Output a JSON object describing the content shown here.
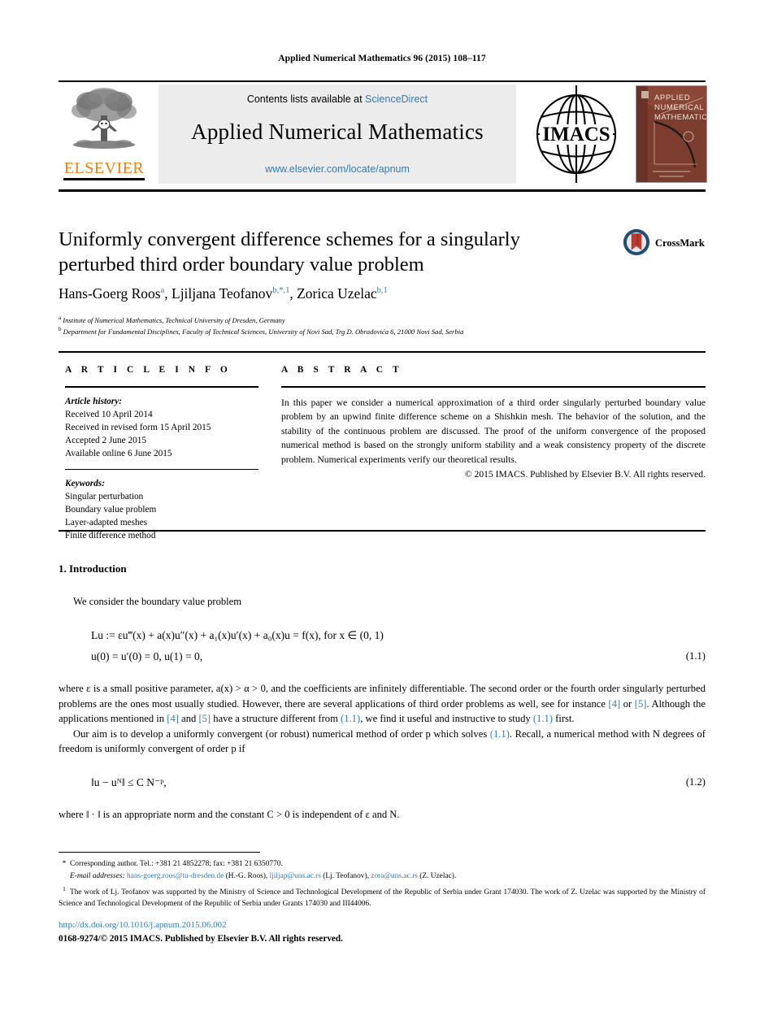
{
  "running_head": "Applied Numerical Mathematics 96 (2015) 108–117",
  "journal_header": {
    "publisher_name": "ELSEVIER",
    "contents_prefix": "Contents lists available at",
    "contents_link": "ScienceDirect",
    "journal_title": "Applied Numerical Mathematics",
    "journal_url": "www.elsevier.com/locate/apnum",
    "society_logo_text": "IMACS",
    "cover_lines": [
      "APPLIED",
      "NUMERICAL",
      "MATHEMATICS"
    ]
  },
  "article": {
    "title_line1": "Uniformly convergent difference schemes for a singularly",
    "title_line2": "perturbed third order boundary value problem",
    "crossmark_label": "CrossMark",
    "authors": [
      {
        "name": "Hans-Goerg Roos",
        "marks": "a"
      },
      {
        "name": "Ljiljana Teofanov",
        "marks": "b,*,1"
      },
      {
        "name": "Zorica Uzelac",
        "marks": "b,1"
      }
    ],
    "affiliations": [
      {
        "mark": "a",
        "text": "Institute of Numerical Mathematics, Technical University of Dresden, Germany"
      },
      {
        "mark": "b",
        "text": "Department for Fundamental Disciplines, Faculty of Technical Sciences, University of Novi Sad, Trg D. Obradovića 6, 21000 Novi Sad, Serbia"
      }
    ]
  },
  "info": {
    "heading": "A R T I C L E   I N F O",
    "history_title": "Article history:",
    "history": [
      "Received 10 April 2014",
      "Received in revised form 15 April 2015",
      "Accepted 2 June 2015",
      "Available online 6 June 2015"
    ],
    "keywords_title": "Keywords:",
    "keywords": [
      "Singular perturbation",
      "Boundary value problem",
      "Layer-adapted meshes",
      "Finite difference method"
    ]
  },
  "abstract": {
    "heading": "A B S T R A C T",
    "text": "In this paper we consider a numerical approximation of a third order singularly perturbed boundary value problem by an upwind finite difference scheme on a Shishkin mesh. The behavior of the solution, and the stability of the continuous problem are discussed. The proof of the uniform convergence of the proposed numerical method is based on the strongly uniform stability and a weak consistency property of the discrete problem. Numerical experiments verify our theoretical results.",
    "copyright": "© 2015 IMACS. Published by Elsevier B.V. All rights reserved."
  },
  "body": {
    "section_number": "1.",
    "section_title": "Introduction",
    "para_intro": "We consider the boundary value problem",
    "eq11_line1": "Lu := εu‴(x) + a(x)u″(x) + a₁(x)u′(x) + a₀(x)u = f(x),    for   x ∈ (0, 1)",
    "eq11_line2": "u(0) = u′(0) = 0,    u(1) = 0,",
    "eq11_num": "(1.1)",
    "para_where_1": "where ε is a small positive parameter, a(x) > α > 0, and the coefficients are infinitely differentiable. The second order or the fourth order singularly perturbed problems are the ones most usually studied. However, there are several applications of third order problems as well, see for instance ",
    "para_where_r1": "[4]",
    "para_where_2": " or ",
    "para_where_r2": "[5]",
    "para_where_3": ". Although the applications mentioned in ",
    "para_where_r3": "[4]",
    "para_where_4": " and ",
    "para_where_r4": "[5]",
    "para_where_5": " have a structure different from ",
    "para_where_r5": "(1.1)",
    "para_where_6": ", we find it useful and instructive to study ",
    "para_where_r6": "(1.1)",
    "para_where_7": " first.",
    "para_aim_1": "Our aim is to develop a uniformly convergent (or robust) numerical method of order p which solves ",
    "para_aim_r1": "(1.1)",
    "para_aim_2": ". Recall, a numerical method with N degrees of freedom is uniformly convergent of order p if",
    "eq12": "‖u − uᴺ‖ ≤ C N⁻ᵖ,",
    "eq12_num": "(1.2)",
    "para_norm": "where ‖ · ‖ is an appropriate norm and the constant C > 0 is independent of ε and N."
  },
  "footnotes": {
    "corresponding_mark": "*",
    "corresponding": "Corresponding author. Tel.: +381 21 4852278; fax: +381 21 6350770.",
    "email_label": "E-mail addresses:",
    "emails": [
      {
        "address": "hans-goerg.roos@tu-dresden.de",
        "owner": "(H.-G. Roos)"
      },
      {
        "address": "ljiljap@uns.ac.rs",
        "owner": "(Lj. Teofanov)"
      },
      {
        "address": "zora@uns.ac.rs",
        "owner": "(Z. Uzelac)"
      }
    ],
    "note_mark": "1",
    "note": "The work of Lj. Teofanov was supported by the Ministry of Science and Technological Development of the Republic of Serbia under Grant 174030. The work of Z. Uzelac was supported by the Ministry of Science and Technological Development of the Republic of Serbia under Grants 174030 and III44006."
  },
  "bottom": {
    "doi": "http://dx.doi.org/10.1016/j.apnum.2015.06.002",
    "issn_copyright": "0168-9274/© 2015 IMACS. Published by Elsevier B.V. All rights reserved."
  },
  "colors": {
    "link": "#2E7EBB",
    "elsevier_orange": "#F07F13",
    "banner_bg": "#ececec",
    "cover_brown": "#7a3b2e",
    "crossmark_blue": "#1f4e79",
    "crossmark_red": "#c0392b"
  }
}
